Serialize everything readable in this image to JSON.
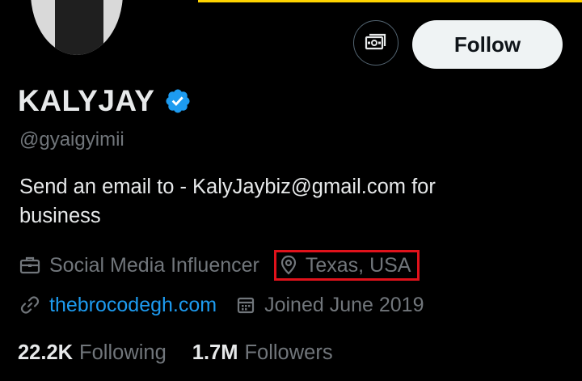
{
  "profile": {
    "display_name": "KALYJAY",
    "handle": "@gyaigyimii",
    "bio": "Send an email to - KalyJaybiz@gmail.com for business",
    "verified": true
  },
  "actions": {
    "tip_icon": "money-icon",
    "follow_label": "Follow"
  },
  "meta": {
    "category": "Social Media Influencer",
    "location": "Texas, USA",
    "website": "thebrocodegh.com",
    "joined": "Joined June 2019"
  },
  "stats": {
    "following_count": "22.2K",
    "following_label": "Following",
    "followers_count": "1.7M",
    "followers_label": "Followers"
  },
  "colors": {
    "background": "#000000",
    "text_primary": "#e7e9ea",
    "text_secondary": "#71767b",
    "link": "#1d9bf0",
    "verified_badge": "#1d9bf0",
    "highlight_box": "#e0121b",
    "banner_accent": "#ffd400"
  }
}
